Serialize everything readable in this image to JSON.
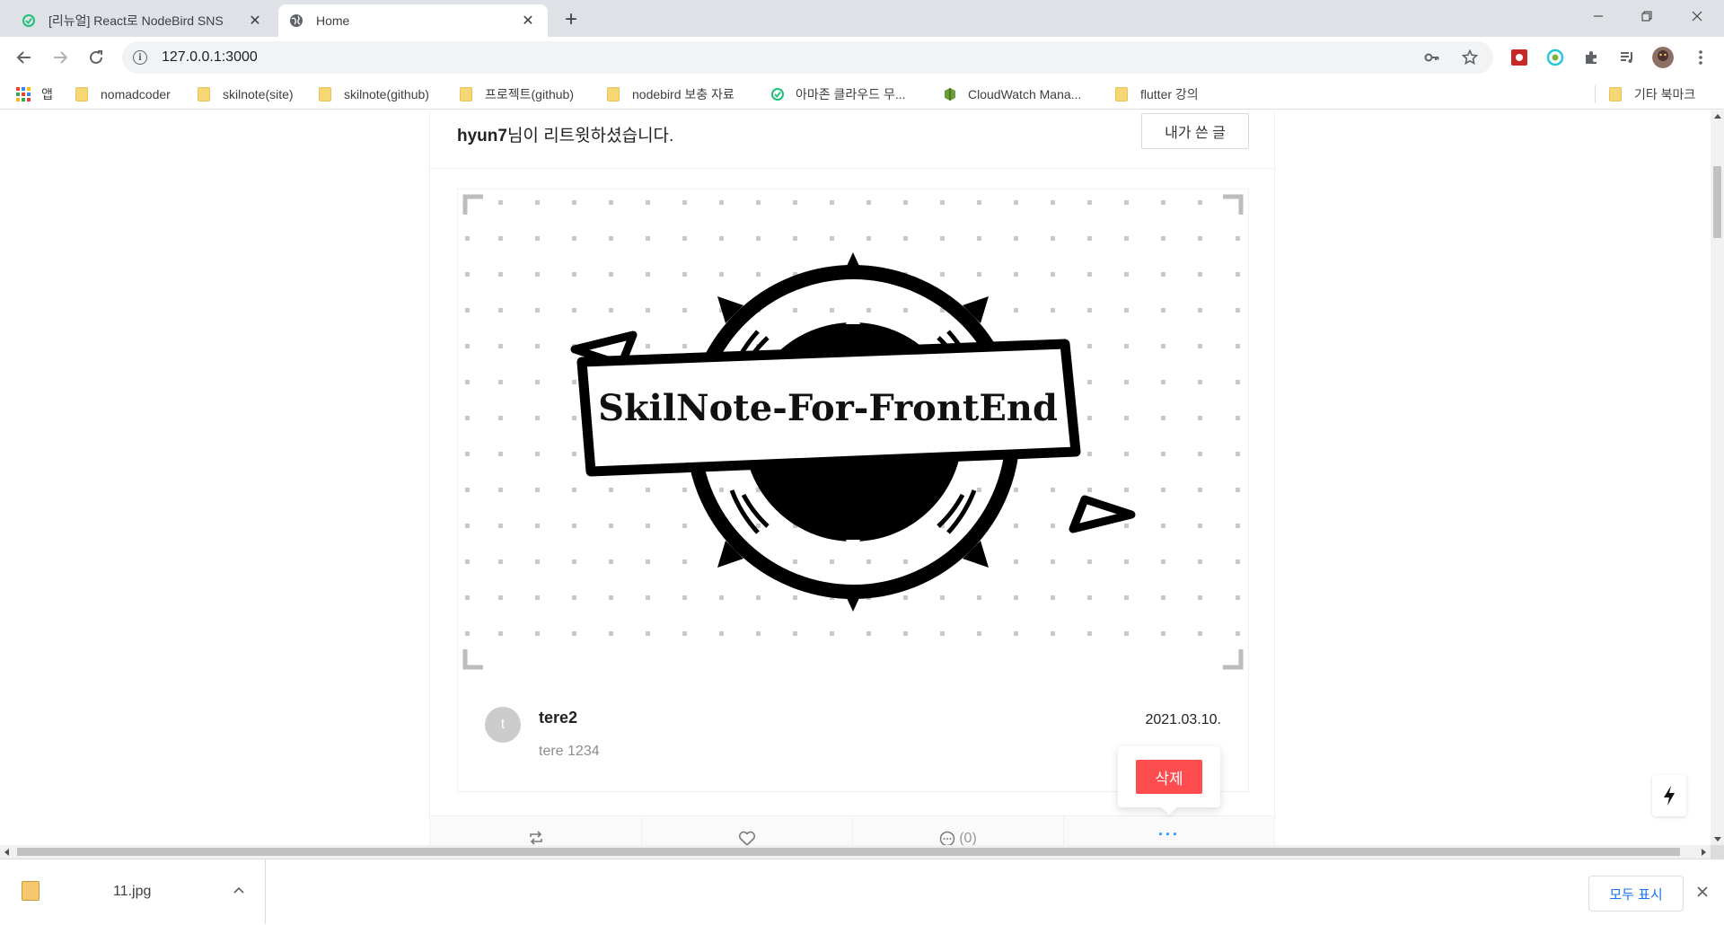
{
  "browser": {
    "tabs": [
      {
        "title": "[리뉴얼] React로 NodeBird SNS",
        "icon": "inflearn-icon",
        "active": false
      },
      {
        "title": "Home",
        "icon": "globe-icon",
        "active": true
      }
    ],
    "new_tab": "+",
    "url": "127.0.0.1:3000",
    "window_controls": {
      "minimize": "—",
      "restore": "❐",
      "close": "✕"
    }
  },
  "bookmarks": [
    {
      "label": "앱",
      "icon": "apps-grid-icon"
    },
    {
      "label": "nomadcoder",
      "icon": "folder-icon"
    },
    {
      "label": "skilnote(site)",
      "icon": "folder-icon"
    },
    {
      "label": "skilnote(github)",
      "icon": "folder-icon"
    },
    {
      "label": "프로젝트(github)",
      "icon": "folder-icon"
    },
    {
      "label": "nodebird 보충 자료",
      "icon": "folder-icon"
    },
    {
      "label": "아마존 클라우드 무...",
      "icon": "inflearn-icon"
    },
    {
      "label": "CloudWatch Mana...",
      "icon": "aws-icon"
    },
    {
      "label": "flutter 강의",
      "icon": "folder-icon"
    },
    {
      "label": "기타 북마크",
      "icon": "folder-icon"
    }
  ],
  "post": {
    "retweet_user": "hyun7",
    "retweet_suffix": "님이 리트윗하셨습니다.",
    "my_posts_button": "내가 쓴 글",
    "image_text": "SkilNote-For-FrontEnd",
    "avatar_initial": "t",
    "author": "tere2",
    "content": "tere 1234",
    "date": "2021.03.10.",
    "comment_count": "(0)",
    "more_label": "···",
    "delete_label": "삭제"
  },
  "downloads": {
    "file_name": "11.jpg",
    "show_all": "모두 표시"
  }
}
